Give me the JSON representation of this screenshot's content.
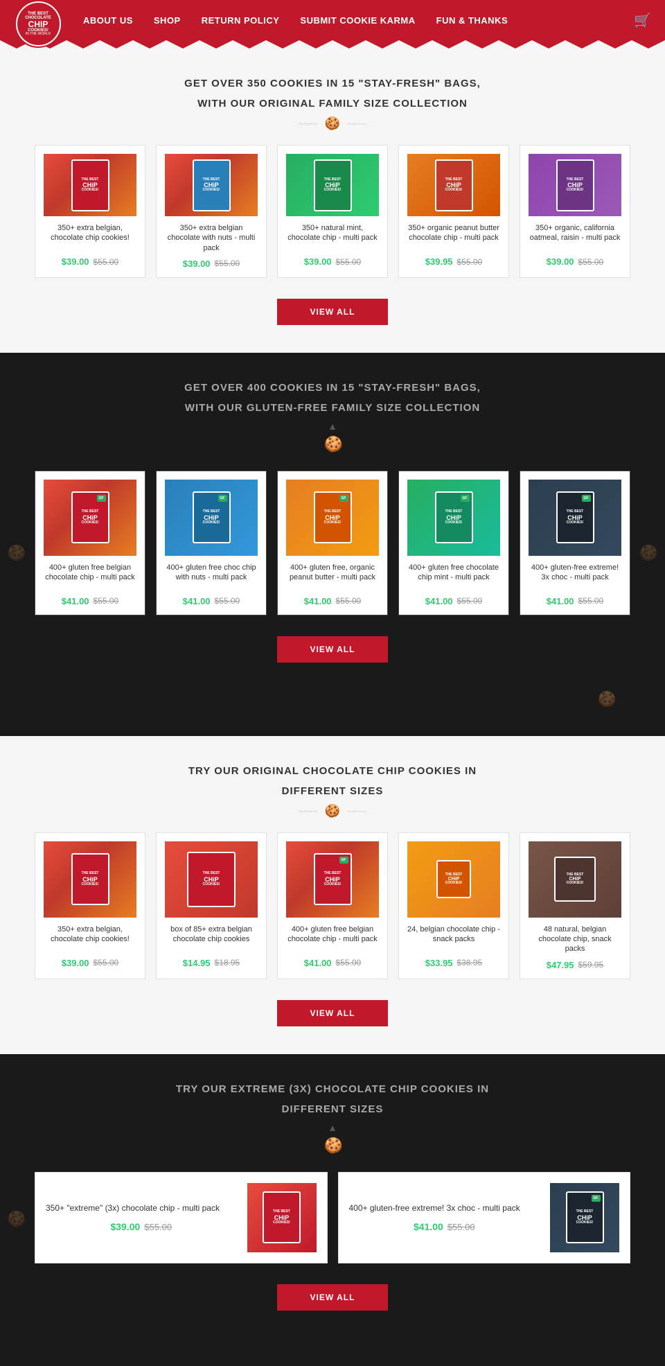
{
  "header": {
    "logo_line1": "THE BEST",
    "logo_line2": "CHOCOLATE",
    "logo_main": "CHiP",
    "logo_line3": "COOKIES!",
    "logo_sub": "IN THE WORLD",
    "nav": [
      {
        "label": "ABOUT US",
        "href": "#"
      },
      {
        "label": "SHOP",
        "href": "#"
      },
      {
        "label": "RETURN POLICY",
        "href": "#"
      },
      {
        "label": "SUBMIT COOKIE KARMA",
        "href": "#"
      },
      {
        "label": "FUN & THANKS",
        "href": "#"
      }
    ],
    "cart_icon": "🛒"
  },
  "section1": {
    "title": "GET OVER 350 COOKIES IN 15 \"STAY-FRESH\" BAGS,",
    "subtitle": "WITH OUR ORIGINAL FAMILY SIZE COLLECTION",
    "products": [
      {
        "name": "350+ extra belgian, chocolate chip cookies!",
        "price_new": "$39.00",
        "price_old": "$55.00"
      },
      {
        "name": "350+ extra belgian chocolate with nuts - multi pack",
        "price_new": "$39.00",
        "price_old": "$55.00"
      },
      {
        "name": "350+ natural mint, chocolate chip - multi pack",
        "price_new": "$39.00",
        "price_old": "$55.00"
      },
      {
        "name": "350+ organic peanut butter chocolate chip - multi pack",
        "price_new": "$39.95",
        "price_old": "$55.00"
      },
      {
        "name": "350+ organic, california oatmeal, raisin - multi pack",
        "price_new": "$39.00",
        "price_old": "$55.00"
      }
    ],
    "view_all": "VIEW ALL"
  },
  "section2": {
    "title": "GET OVER 400 COOKIES IN 15 \"STAY-FRESH\" BAGS,",
    "subtitle": "WITH OUR GLUTEN-FREE FAMILY SIZE COLLECTION",
    "products": [
      {
        "name": "400+ gluten free belgian chocolate chip - multi pack",
        "price_new": "$41.00",
        "price_old": "$55.00"
      },
      {
        "name": "400+ gluten free choc chip with nuts - multi pack",
        "price_new": "$41.00",
        "price_old": "$55.00"
      },
      {
        "name": "400+ gluten free, organic peanut butter - multi pack",
        "price_new": "$41.00",
        "price_old": "$55.00"
      },
      {
        "name": "400+ gluten free chocolate chip mint - multi pack",
        "price_new": "$41.00",
        "price_old": "$55.00"
      },
      {
        "name": "400+ gluten-free extreme! 3x choc - multi pack",
        "price_new": "$41.00",
        "price_old": "$55.00"
      }
    ],
    "view_all": "VIEW ALL"
  },
  "section3": {
    "title": "TRY OUR ORIGINAL CHOCOLATE CHIP COOKIES IN",
    "subtitle": "DIFFERENT SIZES",
    "products": [
      {
        "name": "350+ extra belgian, chocolate chip cookies!",
        "price_new": "$39.00",
        "price_old": "$55.00"
      },
      {
        "name": "box of 85+ extra belgian chocolate chip cookies",
        "price_new": "$14.95",
        "price_old": "$18.95"
      },
      {
        "name": "400+ gluten free belgian chocolate chip - multi pack",
        "price_new": "$41.00",
        "price_old": "$55.00"
      },
      {
        "name": "24, belgian chocolate chip - snack packs",
        "price_new": "$33.95",
        "price_old": "$38.95"
      },
      {
        "name": "48 natural, belgian chocolate chip, snack packs",
        "price_new": "$47.95",
        "price_old": "$59.95"
      }
    ],
    "view_all": "VIEW ALL"
  },
  "section4": {
    "title": "TRY OUR EXTREME (3X) CHOCOLATE CHIP COOKIES IN",
    "subtitle": "DIFFERENT SIZES",
    "products": [
      {
        "name": "350+ \"extreme\" (3x) chocolate chip - multi pack",
        "price_new": "$39.00",
        "price_old": "$55.00"
      },
      {
        "name": "400+ gluten-free extreme! 3x choc - multi pack",
        "price_new": "$41.00",
        "price_old": "$55.00"
      }
    ],
    "view_all": "VIEW ALL"
  },
  "colors": {
    "accent": "#c0192c",
    "price_new": "#2ecc71",
    "price_old": "#999999",
    "dark_bg": "#1a1a1a"
  },
  "icons": {
    "cookie": "🍪",
    "cart": "🛒",
    "triangle": "▲"
  }
}
